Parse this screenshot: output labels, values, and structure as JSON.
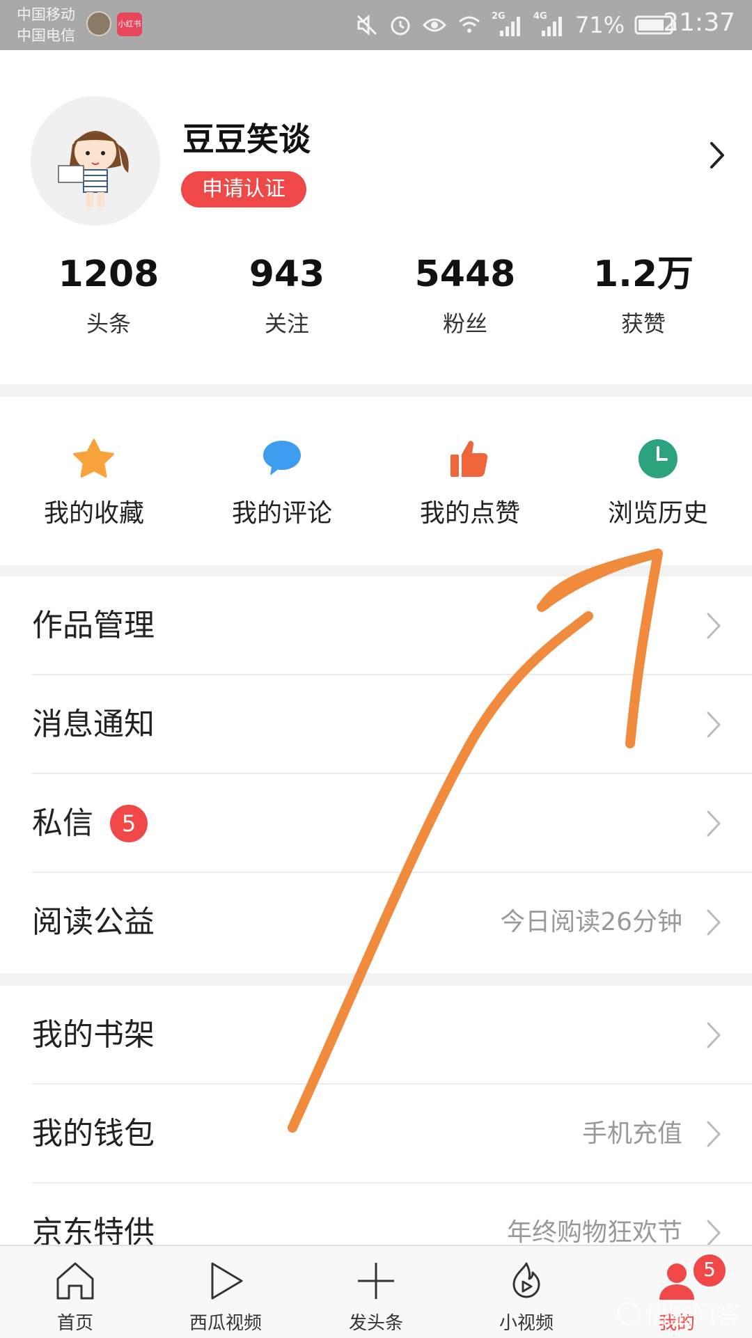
{
  "status_bar": {
    "carrier_1": "中国移动",
    "carrier_2": "中国电信",
    "app_icon_text": "小红书",
    "network_2g": "2G",
    "network_4g": "4G",
    "battery": "71%",
    "time": "21:37"
  },
  "profile": {
    "username": "豆豆笑谈",
    "verify_label": "申请认证",
    "stats": [
      {
        "value": "1208",
        "label": "头条"
      },
      {
        "value": "943",
        "label": "关注"
      },
      {
        "value": "5448",
        "label": "粉丝"
      },
      {
        "value": "1.2万",
        "label": "获赞"
      }
    ]
  },
  "quick_actions": [
    {
      "label": "我的收藏",
      "icon": "star-icon",
      "color": "#f7a23b"
    },
    {
      "label": "我的评论",
      "icon": "comment-icon",
      "color": "#3d9bf0"
    },
    {
      "label": "我的点赞",
      "icon": "thumbs-up-icon",
      "color": "#f0643c"
    },
    {
      "label": "浏览历史",
      "icon": "clock-icon",
      "color": "#2aa37e"
    }
  ],
  "menu_group_1": [
    {
      "label": "作品管理",
      "sub": ""
    },
    {
      "label": "消息通知",
      "sub": ""
    },
    {
      "label": "私信",
      "sub": "",
      "badge": "5"
    },
    {
      "label": "阅读公益",
      "sub": "今日阅读26分钟"
    }
  ],
  "menu_group_2": [
    {
      "label": "我的书架",
      "sub": ""
    },
    {
      "label": "我的钱包",
      "sub": "手机充值"
    },
    {
      "label": "京东特供",
      "sub": "年终购物狂欢节"
    }
  ],
  "tabs": [
    {
      "label": "首页",
      "icon": "home-icon"
    },
    {
      "label": "西瓜视频",
      "icon": "play-icon"
    },
    {
      "label": "发头条",
      "icon": "plus-icon"
    },
    {
      "label": "小视频",
      "icon": "flame-play-icon"
    },
    {
      "label": "我的",
      "icon": "person-icon",
      "badge": "5",
      "active": true
    }
  ],
  "watermark": "悟空问答",
  "colors": {
    "accent_red": "#f04848",
    "annotation_orange": "#f08a3c"
  }
}
